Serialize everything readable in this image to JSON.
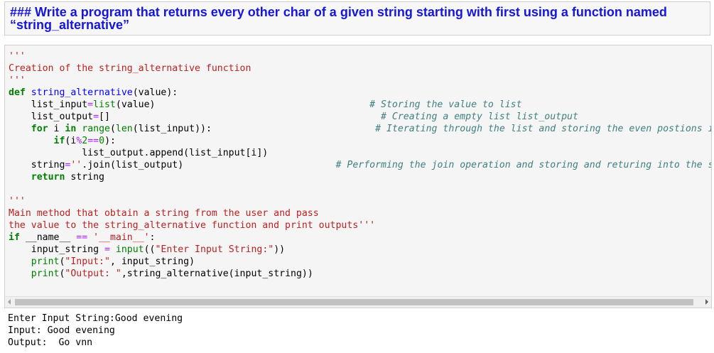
{
  "markdown_cell": {
    "heading": "### Write a program that returns every other char of a given string starting with first using a function named “string_alternative”"
  },
  "code_cell": {
    "lines": [
      [
        {
          "t": "'''",
          "c": "str"
        }
      ],
      [
        {
          "t": "Creation of the string_alternative function",
          "c": "str"
        }
      ],
      [
        {
          "t": "'''",
          "c": "str"
        }
      ],
      [
        {
          "t": "def",
          "c": "kw"
        },
        {
          "t": " ",
          "c": "plain"
        },
        {
          "t": "string_alternative",
          "c": "def"
        },
        {
          "t": "(value):",
          "c": "plain"
        }
      ],
      [
        {
          "t": "    list_input",
          "c": "plain"
        },
        {
          "t": "=",
          "c": "op"
        },
        {
          "t": "list",
          "c": "builtin"
        },
        {
          "t": "(value)                                      ",
          "c": "plain"
        },
        {
          "t": "# Storing the value to list",
          "c": "comment"
        }
      ],
      [
        {
          "t": "    list_output",
          "c": "plain"
        },
        {
          "t": "=",
          "c": "op"
        },
        {
          "t": "[]                                                ",
          "c": "plain"
        },
        {
          "t": "# Creating a empty list list_output",
          "c": "comment"
        }
      ],
      [
        {
          "t": "    ",
          "c": "plain"
        },
        {
          "t": "for",
          "c": "kw"
        },
        {
          "t": " i ",
          "c": "plain"
        },
        {
          "t": "in",
          "c": "kw"
        },
        {
          "t": " ",
          "c": "plain"
        },
        {
          "t": "range",
          "c": "builtin"
        },
        {
          "t": "(",
          "c": "plain"
        },
        {
          "t": "len",
          "c": "builtin"
        },
        {
          "t": "(list_input)):                             ",
          "c": "plain"
        },
        {
          "t": "# Iterating through the list and storing the even postions into list_output",
          "c": "comment"
        }
      ],
      [
        {
          "t": "        ",
          "c": "plain"
        },
        {
          "t": "if",
          "c": "kw"
        },
        {
          "t": "(i",
          "c": "plain"
        },
        {
          "t": "%",
          "c": "op"
        },
        {
          "t": "2",
          "c": "num"
        },
        {
          "t": "==",
          "c": "op"
        },
        {
          "t": "0",
          "c": "num"
        },
        {
          "t": "):",
          "c": "plain"
        }
      ],
      [
        {
          "t": "             list_output.append(list_input[i])",
          "c": "plain"
        }
      ],
      [
        {
          "t": "    string",
          "c": "plain"
        },
        {
          "t": "=",
          "c": "op"
        },
        {
          "t": "''",
          "c": "str"
        },
        {
          "t": ".join(list_output)                           ",
          "c": "plain"
        },
        {
          "t": "# Performing the join operation and storing and returing into the string",
          "c": "comment"
        }
      ],
      [
        {
          "t": "    ",
          "c": "plain"
        },
        {
          "t": "return",
          "c": "kw"
        },
        {
          "t": " string",
          "c": "plain"
        }
      ],
      [
        {
          "t": "",
          "c": "plain"
        }
      ],
      [
        {
          "t": "'''",
          "c": "str"
        }
      ],
      [
        {
          "t": "Main method that obtain a string from the user and pass",
          "c": "str"
        }
      ],
      [
        {
          "t": "the value to the string_alternative function and print outputs'''",
          "c": "str"
        }
      ],
      [
        {
          "t": "if",
          "c": "kw"
        },
        {
          "t": " __name__ ",
          "c": "plain"
        },
        {
          "t": "==",
          "c": "op"
        },
        {
          "t": " ",
          "c": "plain"
        },
        {
          "t": "'__main__'",
          "c": "str"
        },
        {
          "t": ":",
          "c": "plain"
        }
      ],
      [
        {
          "t": "    input_string ",
          "c": "plain"
        },
        {
          "t": "=",
          "c": "op"
        },
        {
          "t": " ",
          "c": "plain"
        },
        {
          "t": "input",
          "c": "builtin"
        },
        {
          "t": "((",
          "c": "plain"
        },
        {
          "t": "\"Enter Input String:\"",
          "c": "str"
        },
        {
          "t": "))",
          "c": "plain"
        }
      ],
      [
        {
          "t": "    ",
          "c": "plain"
        },
        {
          "t": "print",
          "c": "builtin"
        },
        {
          "t": "(",
          "c": "plain"
        },
        {
          "t": "\"Input:\"",
          "c": "str"
        },
        {
          "t": ", input_string)",
          "c": "plain"
        }
      ],
      [
        {
          "t": "    ",
          "c": "plain"
        },
        {
          "t": "print",
          "c": "builtin"
        },
        {
          "t": "(",
          "c": "plain"
        },
        {
          "t": "\"Output: \"",
          "c": "str"
        },
        {
          "t": ",string_alternative(input_string))",
          "c": "plain"
        }
      ]
    ]
  },
  "output": {
    "lines": [
      "Enter Input String:Good evening",
      "Input: Good evening",
      "Output:  Go vnn"
    ]
  },
  "colors": {
    "heading": "#1515e0",
    "string": "#ba2121",
    "keyword": "#008000",
    "function_name": "#0000ff",
    "operator": "#aa22ff",
    "comment": "#408080",
    "cell_background": "#f5f5f5"
  },
  "icons": {
    "scroll_left": "scroll-left-arrow-icon",
    "scroll_right": "scroll-right-arrow-icon"
  }
}
